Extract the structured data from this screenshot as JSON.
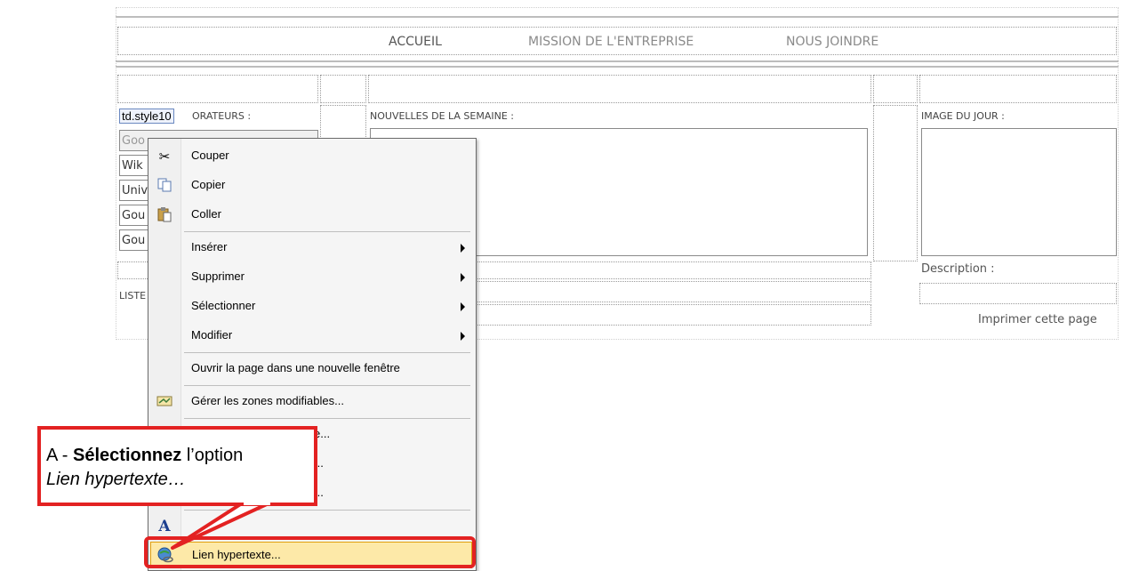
{
  "nav": {
    "home": "ACCUEIL",
    "mission": "MISSION DE L'ENTREPRISE",
    "contact": "NOUS JOINDRE"
  },
  "left": {
    "tag": "td.style10",
    "heading_partial": "ORATEURS :",
    "links": [
      "Goo",
      "Wik",
      "Univ",
      "Gou",
      "Gou"
    ],
    "list_label_partial": "LISTE"
  },
  "center": {
    "heading": "NOUVELLES DE LA SEMAINE :"
  },
  "right": {
    "heading": "IMAGE DU JOUR :",
    "description": "Description :",
    "print": "Imprimer cette page"
  },
  "menu": {
    "items": [
      {
        "label": "Couper",
        "icon": "scissors-icon"
      },
      {
        "label": "Copier",
        "icon": "copy-icon"
      },
      {
        "label": "Coller",
        "icon": "paste-icon"
      },
      {
        "label": "Insérer",
        "submenu": true
      },
      {
        "label": "Supprimer",
        "submenu": true
      },
      {
        "label": "Sélectionner",
        "submenu": true
      },
      {
        "label": "Modifier",
        "submenu": true
      },
      {
        "label": "Ouvrir la page dans une nouvelle fenêtre"
      },
      {
        "label": "Gérer les zones modifiables...",
        "icon": "editable-regions-icon"
      },
      {
        "label": "e..."
      },
      {
        "label": "..."
      },
      {
        "label": "..."
      },
      {
        "label": "...",
        "icon": "font-icon"
      },
      {
        "label": "Lien hypertexte...",
        "icon": "hyperlink-icon",
        "highlighted": true
      }
    ]
  },
  "callout": {
    "prefix": "A - ",
    "bold": "Sélectionnez",
    "middle": " l’option",
    "italic": "Lien hypertexte…"
  },
  "colors": {
    "callout_border": "#e32222",
    "highlight_fill": "#fde9a8",
    "highlight_border": "#e0a010"
  }
}
